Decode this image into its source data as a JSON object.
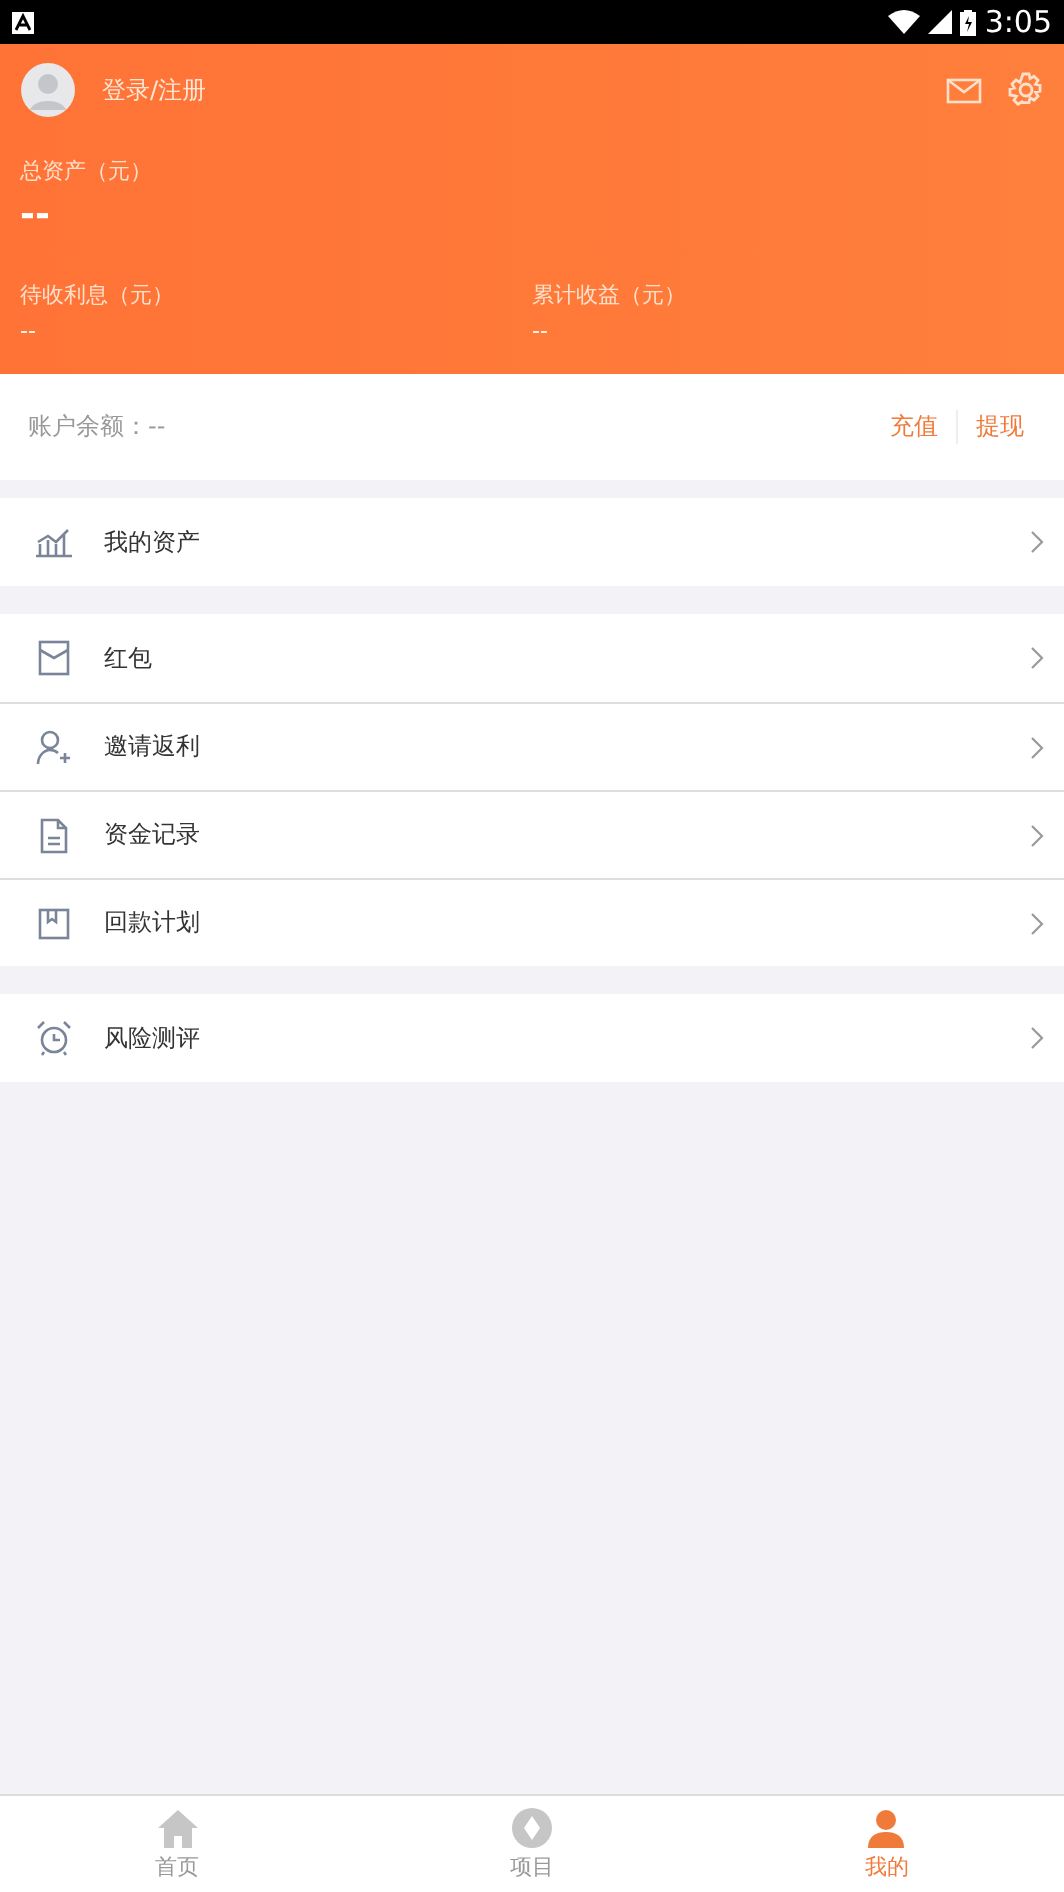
{
  "status_bar": {
    "time": "3:05"
  },
  "header": {
    "login": "登录/注册",
    "total_label": "总资产（元）",
    "total_value": "--",
    "stats": [
      {
        "label": "待收利息（元）",
        "value": "--"
      },
      {
        "label": "累计收益（元）",
        "value": "--"
      }
    ]
  },
  "balance": {
    "label": "账户余额：--",
    "actions": [
      "充值",
      "提现"
    ]
  },
  "menu_groups": [
    [
      {
        "label": "我的资产"
      }
    ],
    [
      {
        "label": "红包"
      },
      {
        "label": "邀请返利"
      },
      {
        "label": "资金记录"
      },
      {
        "label": "回款计划"
      }
    ],
    [
      {
        "label": "风险测评"
      }
    ]
  ],
  "tab_bar": [
    {
      "label": "首页",
      "selected": false
    },
    {
      "label": "项目",
      "selected": false
    },
    {
      "label": "我的",
      "selected": true
    }
  ]
}
